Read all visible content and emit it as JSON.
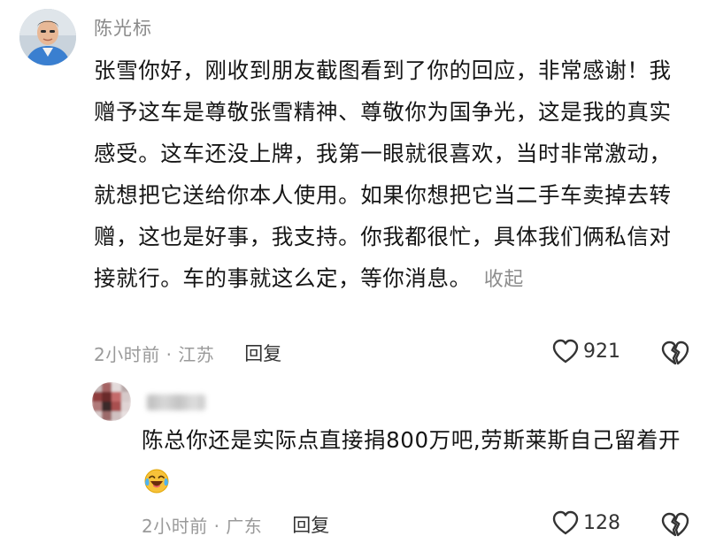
{
  "comments": [
    {
      "username": "陈光标",
      "text": "张雪你好，刚收到朋友截图看到了你的回应，非常感谢！我赠予这车是尊敬张雪精神、尊敬你为国争光，这是我的真实感受。这车还没上牌，我第一眼就很喜欢，当时非常激动，就想把它送给你本人使用。如果你想把它当二手车卖掉去转赠，这也是好事，我支持。你我都很忙，具体我们俩私信对接就行。车的事就这么定，等你消息。",
      "collapse_label": "收起",
      "time_location": "2小时前 · 江苏",
      "reply_label": "回复",
      "like_count": "921"
    }
  ],
  "replies": [
    {
      "text": "陈总你还是实际点直接捐800万吧,劳斯莱斯自己留着开",
      "emoji": "crying-laughing-emoji",
      "time_location": "2小时前 · 广东",
      "reply_label": "回复",
      "like_count": "128"
    }
  ],
  "icons": {
    "like": "heart-outline-icon",
    "dislike": "broken-heart-icon"
  },
  "colors": {
    "text": "#151515",
    "meta": "#9a9a9a",
    "username": "#8a8a8a",
    "icon": "#333333"
  }
}
